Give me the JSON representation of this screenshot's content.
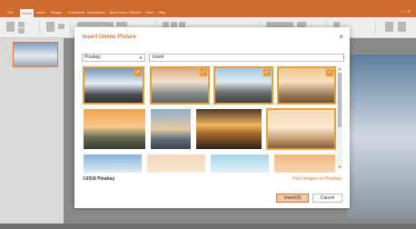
{
  "menu": {
    "items": [
      "File",
      "Home",
      "Insert",
      "Design",
      "Transitions",
      "Animations",
      "Slide Show",
      "Review",
      "View",
      "Help"
    ],
    "active_index": 1
  },
  "dialog": {
    "title": "Insert Online Picture",
    "close_glyph": "×",
    "source": "Pixabay",
    "search_value": "travel",
    "copyright": "©2018 Pixabay",
    "find_link": "Find Images on Pixabay",
    "insert_label": "Insert(4)",
    "cancel_label": "Cancel"
  },
  "images": [
    {
      "selected": true,
      "scene": "friends raising arms on hill"
    },
    {
      "selected": true,
      "scene": "person standing by lake at sunset"
    },
    {
      "selected": true,
      "scene": "person with backpack on rock"
    },
    {
      "selected": true,
      "scene": "woman sitting at sunset beach"
    },
    {
      "selected": false,
      "scene": "windmills at dawn"
    },
    {
      "selected": false,
      "scene": "person on pier at dusk"
    },
    {
      "selected": false,
      "scene": "car on desert road"
    },
    {
      "selected": false,
      "scene": "woman in hat at sunset"
    },
    {
      "selected": false,
      "scene": "mountains"
    },
    {
      "selected": false,
      "scene": "dunes"
    },
    {
      "selected": false,
      "scene": "sea"
    },
    {
      "selected": false,
      "scene": "sunset"
    }
  ],
  "colors": {
    "accent": "#d4763a",
    "selection": "#e3a03c"
  }
}
